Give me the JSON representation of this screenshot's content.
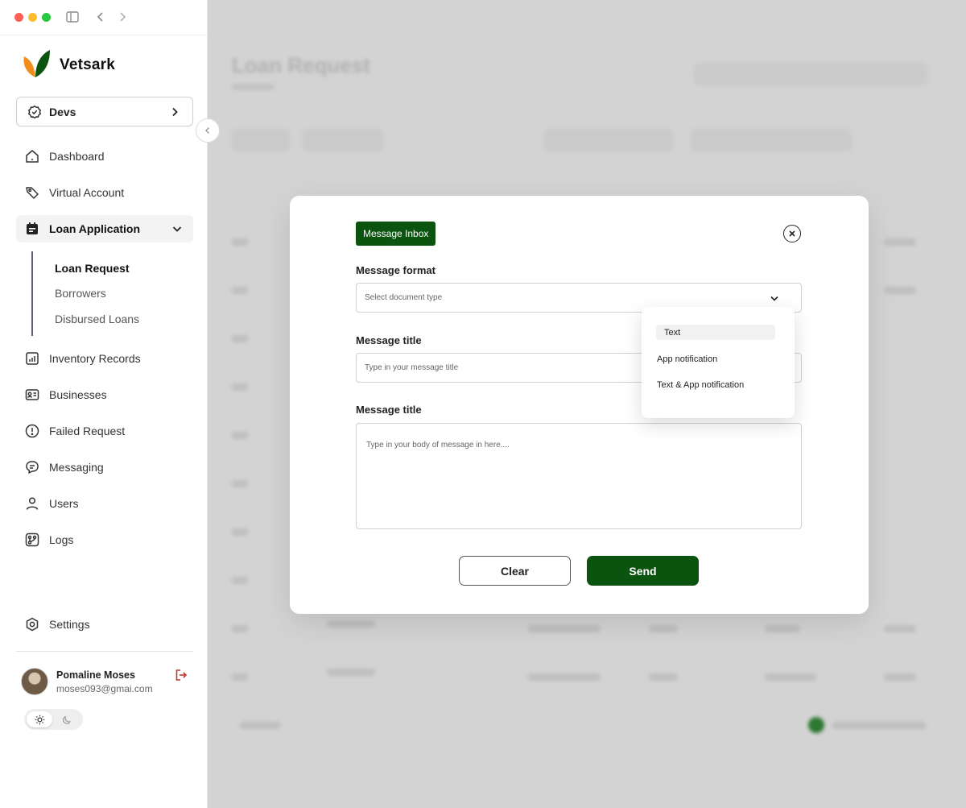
{
  "brand": {
    "name": "Vetsark"
  },
  "workspace": {
    "label": "Devs"
  },
  "nav": {
    "dashboard": "Dashboard",
    "virtual_account": "Virtual Account",
    "loan_application": "Loan Application",
    "loan_sub": [
      "Loan Request",
      "Borrowers",
      "Disbursed Loans"
    ],
    "inventory": "Inventory Records",
    "businesses": "Businesses",
    "failed_request": "Failed Request",
    "messaging": "Messaging",
    "users": "Users",
    "logs": "Logs",
    "settings": "Settings"
  },
  "user": {
    "name": "Pomaline Moses",
    "email": "moses093@gmai.com"
  },
  "background": {
    "title": "Loan Request"
  },
  "modal": {
    "tag": "Message Inbox",
    "format_label": "Message format",
    "format_placeholder": "Select document type",
    "title_label": "Message title",
    "title_placeholder": "Type in your message title",
    "body_label": "Message title",
    "body_placeholder": "Type in your body of message in here....",
    "clear_label": "Clear",
    "send_label": "Send"
  },
  "dropdown": {
    "options": [
      "Text",
      "App notification",
      "Text & App notification"
    ],
    "selected": "Text"
  },
  "colors": {
    "brand_green": "#0b5410",
    "accent_orange": "#f28c1b",
    "logout_red": "#c0392b"
  },
  "icons": {
    "brand": "leaf-logo",
    "workspace": "badge-check-icon",
    "dashboard": "home-icon",
    "virtual_account": "tag-icon",
    "loan_application": "calendar-icon",
    "inventory": "chart-icon",
    "businesses": "id-card-icon",
    "failed_request": "alert-circle-icon",
    "messaging": "chat-icon",
    "users": "user-icon",
    "logs": "git-branch-icon",
    "settings": "settings-icon",
    "logout": "logout-icon",
    "light": "sun-icon",
    "dark": "moon-icon",
    "close": "close-icon"
  }
}
